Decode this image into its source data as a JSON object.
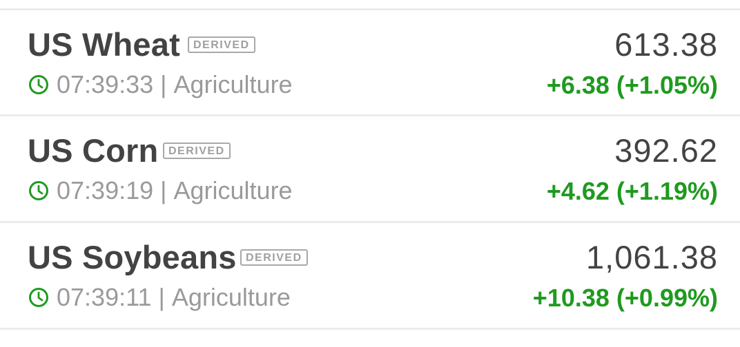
{
  "accent_color": "#1f9a1f",
  "badge_label": "DERIVED",
  "clock_icon": "clock-icon",
  "items": [
    {
      "name": "US Wheat",
      "time": "07:39:33",
      "separator": "|",
      "category": "Agriculture",
      "price": "613.38",
      "change": "+6.38 (+1.05%)"
    },
    {
      "name": "US Corn",
      "time": "07:39:19",
      "separator": "|",
      "category": "Agriculture",
      "price": "392.62",
      "change": "+4.62 (+1.19%)"
    },
    {
      "name": "US Soybeans",
      "time": "07:39:11",
      "separator": "|",
      "category": "Agriculture",
      "price": "1,061.38",
      "change": "+10.38 (+0.99%)"
    }
  ]
}
